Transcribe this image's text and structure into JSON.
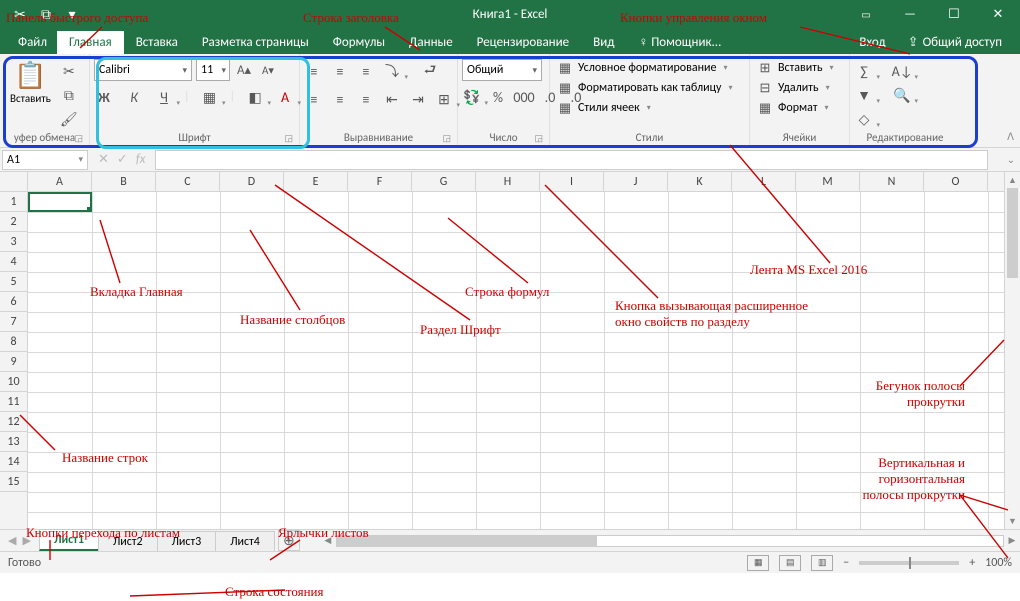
{
  "title": "Книга1 - Excel",
  "tabs": {
    "file": "Файл",
    "home": "Главная",
    "insert": "Вставка",
    "layout": "Разметка страницы",
    "formulas": "Формулы",
    "data": "Данные",
    "review": "Рецензирование",
    "view": "Вид",
    "help": "Помощник...",
    "signin": "Вход",
    "share": "Общий доступ"
  },
  "ribbon": {
    "clipboard": {
      "paste": "Вставить",
      "label": "уфер обмена"
    },
    "font": {
      "name": "Calibri",
      "size": "11",
      "bold": "Ж",
      "italic": "К",
      "underline": "Ч",
      "label": "Шрифт"
    },
    "align": {
      "label": "Выравнивание"
    },
    "number": {
      "format": "Общий",
      "label": "Число"
    },
    "styles": {
      "cond": "Условное форматирование",
      "table": "Форматировать как таблицу",
      "cell": "Стили ячеек",
      "label": "Стили"
    },
    "cells": {
      "insert": "Вставить",
      "delete": "Удалить",
      "format": "Формат",
      "label": "Ячейки"
    },
    "editing": {
      "label": "Редактирование"
    }
  },
  "namebox": "A1",
  "columns": [
    "A",
    "B",
    "C",
    "D",
    "E",
    "F",
    "G",
    "H",
    "I",
    "J",
    "K",
    "L",
    "M",
    "N",
    "O"
  ],
  "rows": [
    "1",
    "2",
    "3",
    "4",
    "5",
    "6",
    "7",
    "8",
    "9",
    "10",
    "11",
    "12",
    "13",
    "14",
    "15"
  ],
  "sheets": [
    "Лист1",
    "Лист2",
    "Лист3",
    "Лист4"
  ],
  "status": {
    "ready": "Готово",
    "zoom": "100%"
  },
  "anno": {
    "qat": "Панель быстрого доступа",
    "titlebar": "Строка заголовка",
    "winctrl": "Кнопки управления окном",
    "hometab": "Вкладка Главная",
    "colnames": "Название столбцов",
    "fontsection": "Раздел Шрифт",
    "formulabar": "Строка формул",
    "launcher": "Кнопка вызывающая расширенное окно свойств по разделу",
    "ribbon": "Лента MS Excel 2016",
    "rownames": "Название строк",
    "scrollthumb": "Бегунок полосы прокрутки",
    "scrollbars": "Вертикальная и горизонтальная полосы прокрутки",
    "sheetnav": "Кнопки перехода по листам",
    "sheettabs": "Ярлычки листов",
    "statusbar": "Строка состояния"
  }
}
